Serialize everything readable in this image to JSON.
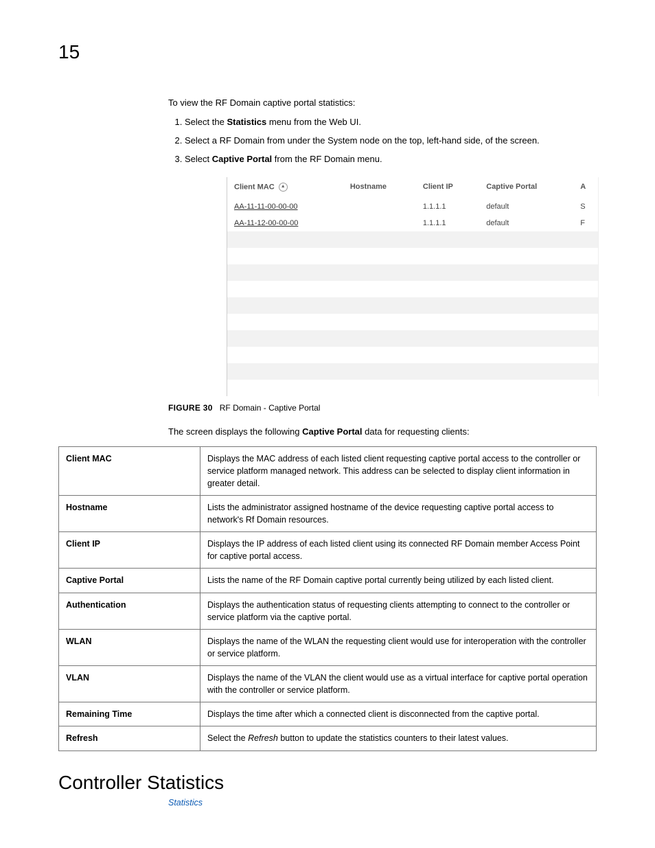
{
  "chapter_number": "15",
  "intro": "To view the RF Domain captive portal statistics:",
  "steps": [
    {
      "before": "Select the ",
      "bold": "Statistics",
      "after": " menu from the Web UI."
    },
    {
      "before": "Select a RF Domain from under the System node on the top, left-hand side, of the screen.",
      "bold": "",
      "after": ""
    },
    {
      "before": "Select ",
      "bold": "Captive Portal",
      "after": " from the RF Domain menu."
    }
  ],
  "screenshot": {
    "headers": [
      "Client MAC",
      "Hostname",
      "Client IP",
      "Captive Portal",
      "A"
    ],
    "rows": [
      {
        "mac": "AA-11-11-00-00-00",
        "hostname": "",
        "ip": "1.1.1.1",
        "portal": "default",
        "extra": "S"
      },
      {
        "mac": "AA-11-12-00-00-00",
        "hostname": "",
        "ip": "1.1.1.1",
        "portal": "default",
        "extra": "F"
      }
    ]
  },
  "figure": {
    "label": "FIGURE 30",
    "caption": "RF Domain - Captive Portal"
  },
  "desc_intro": {
    "before": "The screen displays the following ",
    "bold": "Captive Portal",
    "after": " data for requesting clients:"
  },
  "desc_rows": [
    {
      "label": "Client MAC",
      "text": "Displays the MAC address of each listed client requesting captive portal access to the controller or service platform managed network. This address can be selected to display client information in greater detail."
    },
    {
      "label": "Hostname",
      "text": "Lists the administrator assigned hostname of the device requesting captive portal access to network's Rf Domain resources."
    },
    {
      "label": "Client IP",
      "text": "Displays the IP address of each listed client using its connected RF Domain member Access Point for captive portal access."
    },
    {
      "label": "Captive Portal",
      "text": "Lists the name of the RF Domain captive portal currently being utilized by each listed client."
    },
    {
      "label": "Authentication",
      "text": "Displays the authentication status of requesting clients attempting to connect to the controller or service platform via the captive portal."
    },
    {
      "label": "WLAN",
      "text": "Displays the name of the WLAN the requesting client would use for interoperation with the controller or service platform."
    },
    {
      "label": "VLAN",
      "text": "Displays the name of the VLAN the client would use as a virtual interface for captive portal operation with the controller or service platform."
    },
    {
      "label": "Remaining Time",
      "text": "Displays the time after which a connected client is disconnected from the captive portal."
    },
    {
      "label": "Refresh",
      "text_before": "Select the ",
      "text_italic": "Refresh",
      "text_after": " button to update the statistics counters to their latest values."
    }
  ],
  "section_heading": "Controller Statistics",
  "breadcrumb": "Statistics"
}
